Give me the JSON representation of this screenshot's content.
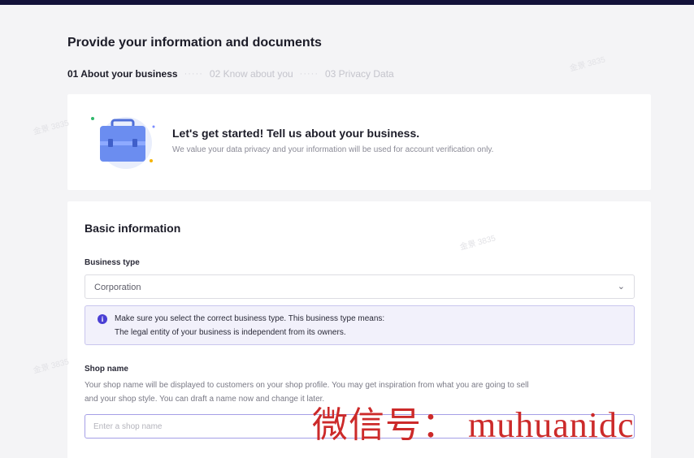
{
  "page_title": "Provide your information and documents",
  "steps": [
    {
      "label": "01 About your business",
      "active": true
    },
    {
      "label": "02 Know about you",
      "active": false
    },
    {
      "label": "03 Privacy Data",
      "active": false
    }
  ],
  "step_separator": "·····",
  "hero": {
    "title": "Let's get started! Tell us about your business.",
    "subtitle": "We value your data privacy and your information will be used for account verification only.",
    "illustration": "briefcase-illustration"
  },
  "basic_info": {
    "section_title": "Basic information",
    "business_type": {
      "label": "Business type",
      "value": "Corporation",
      "icon": "chevron-down-icon"
    },
    "notice": {
      "icon": "info-icon",
      "line1": "Make sure you select the correct business type. This business type means:",
      "line2": "The legal entity of your business is independent from its owners."
    },
    "shop_name": {
      "label": "Shop name",
      "help_line1": "Your shop name will be displayed to customers on your shop profile. You may get inspiration from what you are going to sell",
      "help_line2": "and your shop style. You can draft a name now and change it later.",
      "placeholder": "Enter a shop name",
      "value": ""
    }
  },
  "watermark": "金景 3835",
  "overlay_caption": "微信号： muhuanidc",
  "colors": {
    "topbar": "#13123a",
    "accent": "#4a3fd4",
    "notice_bg": "#f2f1fb",
    "notice_border": "#c9c6ee",
    "caption": "#cc2a2a"
  }
}
